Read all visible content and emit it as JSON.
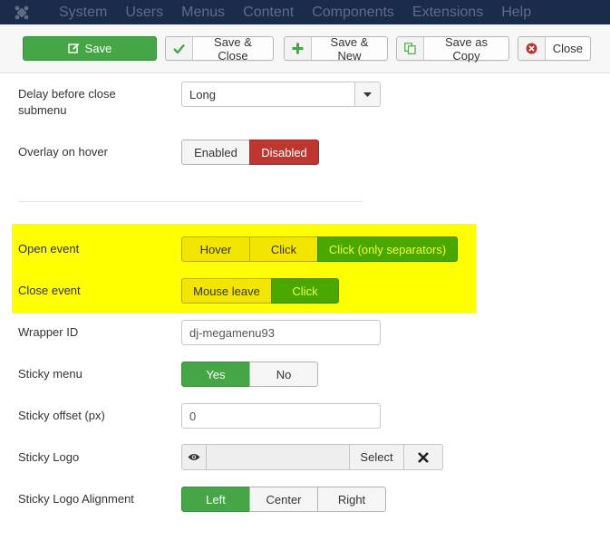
{
  "navbar": {
    "items": [
      "System",
      "Users",
      "Menus",
      "Content",
      "Components",
      "Extensions",
      "Help"
    ]
  },
  "toolbar": {
    "save": "Save",
    "save_close": "Save & Close",
    "save_new": "Save & New",
    "save_copy": "Save as Copy",
    "close": "Close"
  },
  "form": {
    "delay_label_line1": "Delay before close",
    "delay_label_line2": "submenu",
    "delay_value": "Long",
    "overlay_label": "Overlay on hover",
    "overlay_options": [
      "Enabled",
      "Disabled"
    ],
    "open_label": "Open event",
    "open_options": [
      "Hover",
      "Click",
      "Click (only separators)"
    ],
    "close_label": "Close event",
    "close_options": [
      "Mouse leave",
      "Click"
    ],
    "wrapper_label": "Wrapper ID",
    "wrapper_value": "dj-megamenu93",
    "sticky_label": "Sticky menu",
    "sticky_options": [
      "Yes",
      "No"
    ],
    "offset_label": "Sticky offset (px)",
    "offset_value": "0",
    "logo_label": "Sticky Logo",
    "logo_select": "Select",
    "align_label": "Sticky Logo Alignment",
    "align_options": [
      "Left",
      "Center",
      "Right"
    ]
  },
  "colors": {
    "navbar": "#1b2b4c",
    "save_green": "#46a546",
    "disabled_red": "#bd362f",
    "highlight_yellow": "#ffff00"
  }
}
